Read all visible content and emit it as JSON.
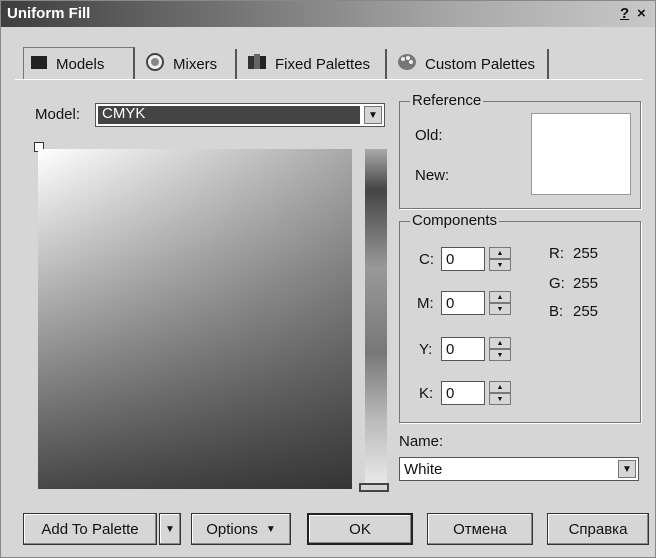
{
  "window": {
    "title": "Uniform Fill",
    "help": "?",
    "close": "×"
  },
  "tabs": [
    {
      "label": "Models",
      "icon": "square-icon",
      "active": true
    },
    {
      "label": "Mixers",
      "icon": "circle-icon",
      "active": false
    },
    {
      "label": "Fixed Palettes",
      "icon": "palette-book-icon",
      "active": false
    },
    {
      "label": "Custom Palettes",
      "icon": "paint-palette-icon",
      "active": false
    }
  ],
  "model": {
    "label": "Model:",
    "value": "CMYK"
  },
  "reference": {
    "title": "Reference",
    "old_label": "Old:",
    "new_label": "New:",
    "swatch_color": "#ffffff"
  },
  "components": {
    "title": "Components",
    "c": {
      "label": "C:",
      "value": "0"
    },
    "m": {
      "label": "M:",
      "value": "0"
    },
    "y": {
      "label": "Y:",
      "value": "0"
    },
    "k": {
      "label": "K:",
      "value": "0"
    },
    "r": {
      "label": "R:",
      "value": "255"
    },
    "g": {
      "label": "G:",
      "value": "255"
    },
    "b": {
      "label": "B:",
      "value": "255"
    }
  },
  "name": {
    "label": "Name:",
    "value": "White"
  },
  "buttons": {
    "add_to_palette": "Add To Palette",
    "options": "Options",
    "ok": "OK",
    "cancel": "Отмена",
    "help": "Справка"
  }
}
